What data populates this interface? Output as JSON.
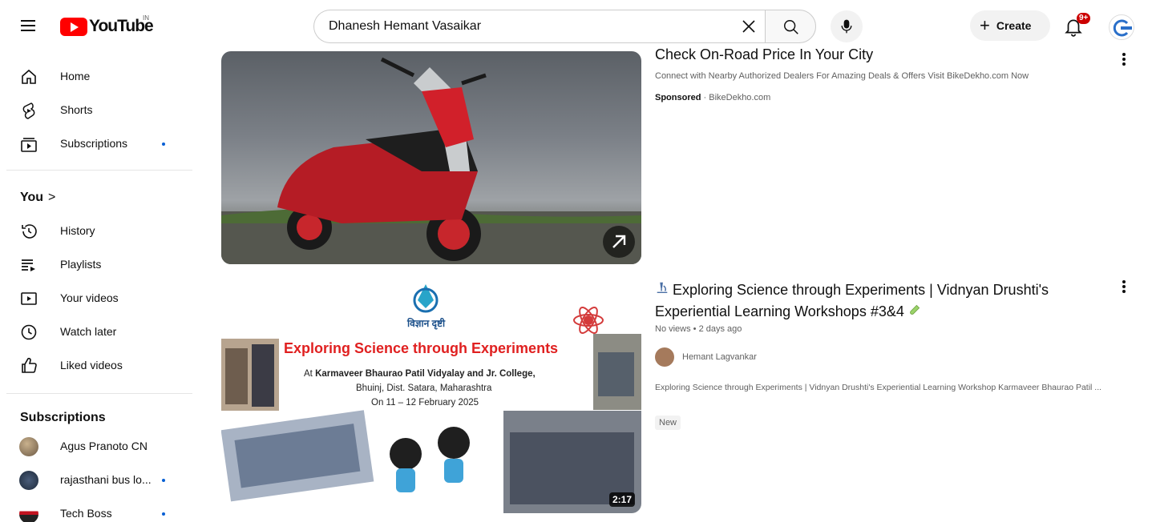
{
  "header": {
    "logo_text": "YouTube",
    "logo_region": "IN",
    "search_value": "Dhanesh Hemant Vasaikar",
    "create_label": "Create",
    "notifications_badge": "9+"
  },
  "sidebar": {
    "main_items": [
      {
        "label": "Home",
        "icon": "home-icon"
      },
      {
        "label": "Shorts",
        "icon": "shorts-icon"
      },
      {
        "label": "Subscriptions",
        "icon": "subscriptions-icon",
        "dot": true
      }
    ],
    "you_section": {
      "title": "You",
      "chevron": ">",
      "items": [
        {
          "label": "History",
          "icon": "history-icon"
        },
        {
          "label": "Playlists",
          "icon": "playlists-icon"
        },
        {
          "label": "Your videos",
          "icon": "your-videos-icon"
        },
        {
          "label": "Watch later",
          "icon": "watch-later-icon"
        },
        {
          "label": "Liked videos",
          "icon": "liked-videos-icon"
        }
      ]
    },
    "subscriptions_section": {
      "title": "Subscriptions",
      "items": [
        {
          "label": "Agus Pranoto CN",
          "dot": false
        },
        {
          "label": "rajasthani bus lo...",
          "dot": true
        },
        {
          "label": "Tech Boss",
          "dot": true
        }
      ]
    }
  },
  "results": [
    {
      "title": "Check On-Road Price In Your City",
      "description": "Connect with Nearby Authorized Dealers For Amazing Deals & Offers Visit BikeDekho.com Now",
      "sponsored_label": "Sponsored",
      "sponsored_source": " · BikeDekho.com"
    },
    {
      "title_prefix_icon": "microscope-icon",
      "title": "Exploring Science through Experiments | Vidnyan Drushti's Experiential Learning Workshops #3&4",
      "meta": "No views • 2 days ago",
      "channel": "Hemant Lagvankar",
      "description": "Exploring Science through Experiments | Vidnyan Drushti's Experiential Learning Workshop Karmaveer Bhaurao Patil ...",
      "badge": "New",
      "duration": "2:17",
      "thumbnail": {
        "org_name": "विज्ञान दृष्टी",
        "heading": "Exploring Science through Experiments",
        "venue_prefix": "At ",
        "venue_bold": "Karmaveer Bhaurao Patil Vidyalay and Jr. College,",
        "location": "Bhuinj, Dist. Satara, Maharashtra",
        "dates": "On 11 – 12 February 2025"
      }
    }
  ],
  "colors": {
    "brand_red": "#ff0000",
    "thumbnail_heading": "#e02020",
    "link_blue": "#065fd4"
  }
}
